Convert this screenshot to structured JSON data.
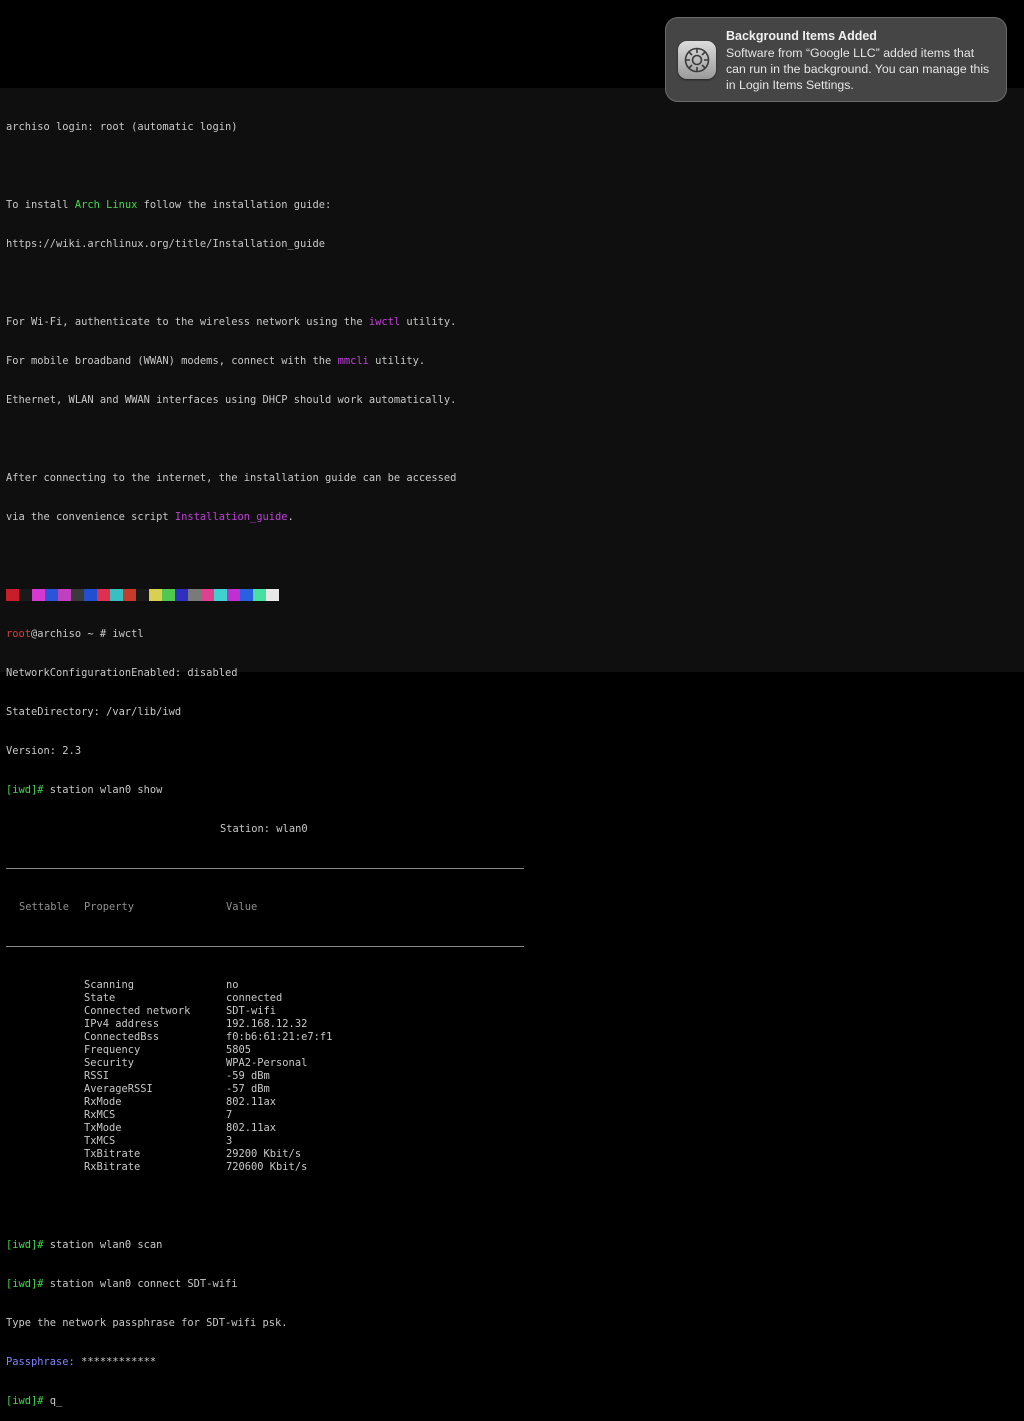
{
  "notification": {
    "title": "Background Items Added",
    "body": "Software from “Google LLC” added items that can run in the background. You can manage this in Login Items Settings.",
    "icon": "gear-icon"
  },
  "terminal": {
    "login_line": "archiso login: root (automatic login)",
    "install_prefix": "To install ",
    "install_arch": "Arch Linux",
    "install_suffix": " follow the installation guide:",
    "install_url": "https://wiki.archlinux.org/title/Installation_guide",
    "wifi_prefix": "For Wi-Fi, authenticate to the wireless network using the ",
    "wifi_tool": "iwctl",
    "wifi_suffix": " utility.",
    "mobile_prefix": "For mobile broadband (WWAN) modems, connect with the ",
    "mobile_tool": "mmcli",
    "mobile_suffix": " utility.",
    "ethernet_line": "Ethernet, WLAN and WWAN interfaces using DHCP should work automatically.",
    "after_line": "After connecting to the internet, the installation guide can be accessed",
    "convenience_prefix": "via the convenience script ",
    "convenience_script": "Installation_guide",
    "convenience_suffix": ".",
    "prompt_user": "root",
    "prompt_host": "@archiso ~ # ",
    "prompt_cmd": "iwctl",
    "netcfg_line": "NetworkConfigurationEnabled: disabled",
    "statedir_line": "StateDirectory: /var/lib/iwd",
    "version_line": "Version: 2.3",
    "iwd_prompt": "[iwd]# ",
    "show_cmd": "station wlan0 show",
    "station_title": "Station: wlan0",
    "table_headers": [
      "Settable",
      "Property",
      "Value"
    ],
    "table_rows": [
      {
        "property": "Scanning",
        "value": "no"
      },
      {
        "property": "State",
        "value": "connected"
      },
      {
        "property": "Connected network",
        "value": "SDT-wifi"
      },
      {
        "property": "IPv4 address",
        "value": "192.168.12.32"
      },
      {
        "property": "ConnectedBss",
        "value": "f0:b6:61:21:e7:f1"
      },
      {
        "property": "Frequency",
        "value": "5805"
      },
      {
        "property": "Security",
        "value": "WPA2-Personal"
      },
      {
        "property": "RSSI",
        "value": "-59 dBm"
      },
      {
        "property": "AverageRSSI",
        "value": "-57 dBm"
      },
      {
        "property": "RxMode",
        "value": "802.11ax"
      },
      {
        "property": "RxMCS",
        "value": "7"
      },
      {
        "property": "TxMode",
        "value": "802.11ax"
      },
      {
        "property": "TxMCS",
        "value": "3"
      },
      {
        "property": "TxBitrate",
        "value": "29200 Kbit/s"
      },
      {
        "property": "RxBitrate",
        "value": "720600 Kbit/s"
      }
    ],
    "scan_cmd": "station wlan0 scan",
    "connect_cmd": "station wlan0 connect SDT-wifi",
    "passphrase_line": "Type the network passphrase for SDT-wifi psk.",
    "passphrase_label": "Passphrase:",
    "passphrase_value": " ************",
    "current_input": "q_"
  },
  "colors": {
    "green": "#3fd94a",
    "magenta": "#c040d8",
    "red": "#e03a3a",
    "notification_bg": "#484848"
  }
}
